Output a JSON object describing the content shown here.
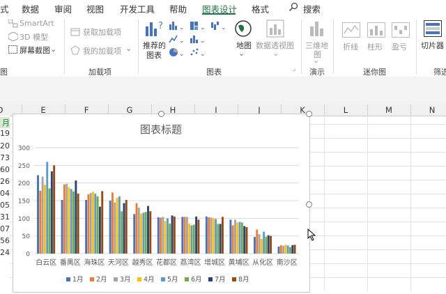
{
  "ribbon": {
    "tabs": [
      {
        "label": "式",
        "active": false
      },
      {
        "label": "数据",
        "active": false
      },
      {
        "label": "审阅",
        "active": false
      },
      {
        "label": "视图",
        "active": false
      },
      {
        "label": "开发工具",
        "active": false
      },
      {
        "label": "帮助",
        "active": false
      },
      {
        "label": "图表设计",
        "active": true
      },
      {
        "label": "格式",
        "active": false
      }
    ],
    "search_label": "搜索",
    "illustrations": {
      "smartart": "SmartArt",
      "model3d": "3D 模型",
      "screenshot": "屏幕截图",
      "group_label": "图"
    },
    "addins": {
      "get_addins": "获取加载项",
      "my_addins": "我的加载项",
      "group_label": "加载项"
    },
    "charts": {
      "recommended_line1": "推荐的",
      "recommended_line2": "图表",
      "map": "地图",
      "pivot_chart": "数据透视图",
      "group_label": "图表"
    },
    "tours": {
      "map3d_line1": "三维地",
      "map3d_line2": "图",
      "group_label": "演示"
    },
    "sparklines": {
      "line": "折线",
      "column": "柱形",
      "winloss": "盈亏",
      "group_label": "迷你图"
    },
    "filters": {
      "slicer": "切片器",
      "group_label": "筛选"
    }
  },
  "sheet": {
    "columns": [
      "D",
      "E",
      "F",
      "G",
      "H",
      "I",
      "J",
      "K",
      "L",
      "M",
      "N"
    ],
    "row_fragments": [
      "月",
      "19",
      "20",
      "73",
      "60",
      "26",
      "04",
      "05",
      "31",
      "07",
      "56",
      "24"
    ]
  },
  "colors": {
    "accent": "#217346",
    "series": [
      "#4472c4",
      "#ed7d31",
      "#a5a5a5",
      "#ffc000",
      "#5b9bd5",
      "#70ad47",
      "#264478",
      "#9e480e"
    ]
  },
  "chart_data": {
    "type": "bar",
    "title": "图表标题",
    "categories": [
      "白云区",
      "番禺区",
      "海珠区",
      "天河区",
      "越秀区",
      "花都区",
      "荔湾区",
      "增城区",
      "黄埔区",
      "从化区",
      "南沙区"
    ],
    "ylim": [
      0,
      300
    ],
    "yticks": [
      0,
      50,
      100,
      150,
      200,
      250,
      300
    ],
    "grid": true,
    "legend_position": "bottom",
    "series": [
      {
        "name": "1月",
        "values": [
          222,
          152,
          152,
          150,
          112,
          103,
          104,
          105,
          96,
          47,
          20
        ]
      },
      {
        "name": "2月",
        "values": [
          178,
          196,
          168,
          173,
          143,
          102,
          104,
          103,
          80,
          68,
          24
        ]
      },
      {
        "name": "3月",
        "values": [
          218,
          198,
          172,
          145,
          130,
          104,
          104,
          102,
          96,
          55,
          22
        ]
      },
      {
        "name": "4月",
        "values": [
          195,
          188,
          175,
          158,
          113,
          92,
          85,
          100,
          88,
          42,
          25
        ]
      },
      {
        "name": "5月",
        "values": [
          260,
          183,
          170,
          162,
          116,
          100,
          80,
          98,
          90,
          62,
          23
        ]
      },
      {
        "name": "6月",
        "values": [
          185,
          176,
          162,
          120,
          118,
          85,
          82,
          84,
          88,
          48,
          18
        ]
      },
      {
        "name": "7月",
        "values": [
          233,
          207,
          133,
          143,
          135,
          108,
          105,
          84,
          78,
          52,
          24
        ]
      },
      {
        "name": "8月",
        "values": [
          250,
          170,
          177,
          152,
          120,
          105,
          96,
          104,
          75,
          50,
          25
        ]
      }
    ]
  }
}
